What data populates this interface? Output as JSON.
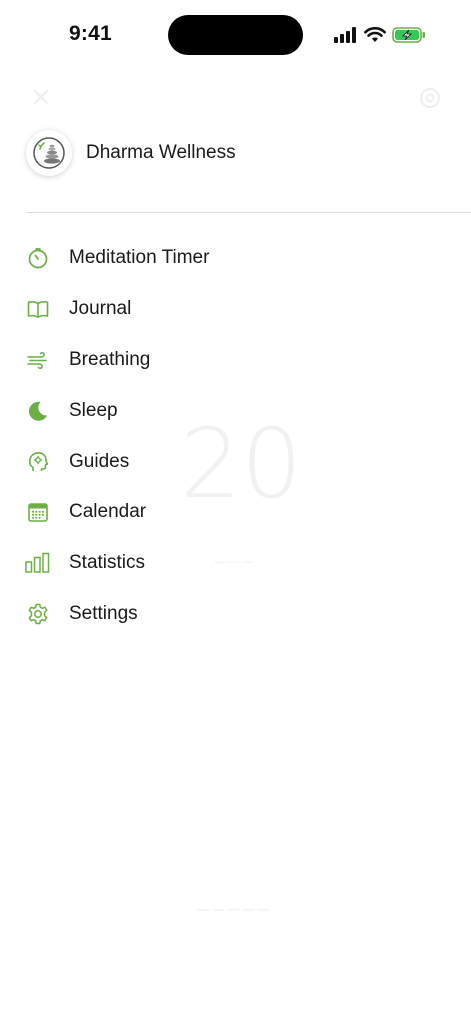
{
  "status_bar": {
    "time": "9:41"
  },
  "profile": {
    "name": "Dharma Wellness"
  },
  "menu": {
    "items": [
      {
        "label": "Meditation Timer",
        "icon": "timer-icon"
      },
      {
        "label": "Journal",
        "icon": "book-icon"
      },
      {
        "label": "Breathing",
        "icon": "wind-icon"
      },
      {
        "label": "Sleep",
        "icon": "moon-icon"
      },
      {
        "label": "Guides",
        "icon": "head-icon"
      },
      {
        "label": "Calendar",
        "icon": "calendar-icon"
      },
      {
        "label": "Statistics",
        "icon": "bar-chart-icon"
      },
      {
        "label": "Settings",
        "icon": "gear-icon"
      }
    ]
  },
  "background": {
    "timer_value": "20"
  },
  "colors": {
    "accent": "#6BAF45",
    "text": "#1a1a1a",
    "divider": "#dedede"
  }
}
